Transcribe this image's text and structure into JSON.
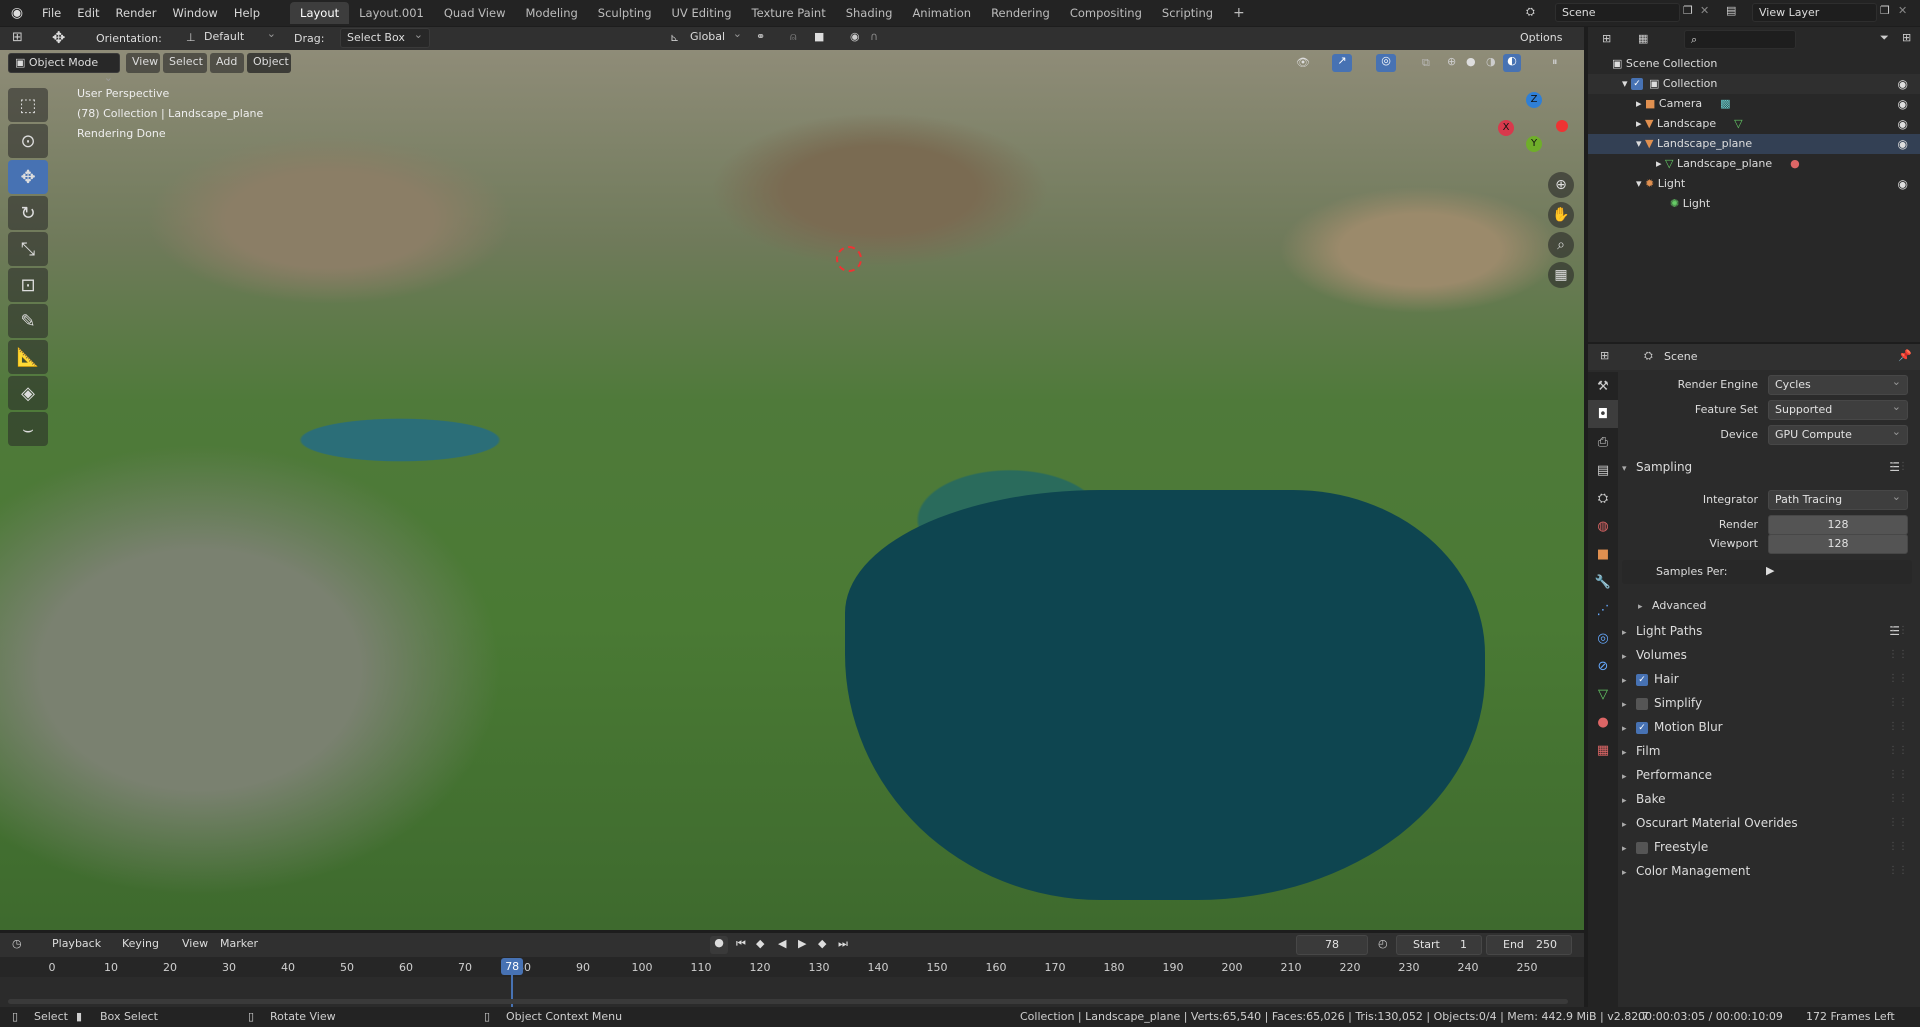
{
  "topbar": {
    "menus": [
      "File",
      "Edit",
      "Render",
      "Window",
      "Help"
    ],
    "workspaces": [
      "Layout",
      "Layout.001",
      "Quad View",
      "Modeling",
      "Sculpting",
      "UV Editing",
      "Texture Paint",
      "Shading",
      "Animation",
      "Rendering",
      "Compositing",
      "Scripting"
    ],
    "add_tab": "+",
    "scene": "Scene",
    "view_layer": "View Layer"
  },
  "view_header": {
    "orientation_label": "Orientation:",
    "orientation_value": "Default",
    "drag_label": "Drag:",
    "drag_value": "Select Box",
    "transform_orientation": "Global",
    "options": "Options",
    "mode": "Object Mode",
    "view": "View",
    "select": "Select",
    "add": "Add",
    "object": "Object"
  },
  "viewport": {
    "perspective": "User Perspective",
    "collection": "(78) Collection | Landscape_plane",
    "status": "Rendering Done",
    "gizmo_axes": {
      "x": "X",
      "y": "Y",
      "z": "Z"
    }
  },
  "outliner": {
    "root": "Scene Collection",
    "items": [
      {
        "label": "Collection",
        "indent": 1
      },
      {
        "label": "Camera",
        "indent": 2
      },
      {
        "label": "Landscape",
        "indent": 2
      },
      {
        "label": "Landscape_plane",
        "indent": 2
      },
      {
        "label": "Landscape_plane",
        "indent": 3
      },
      {
        "label": "Light",
        "indent": 2
      },
      {
        "label": "Light",
        "indent": 3
      }
    ]
  },
  "properties": {
    "context": "Scene",
    "render_engine_label": "Render Engine",
    "render_engine": "Cycles",
    "feature_set_label": "Feature Set",
    "feature_set": "Supported",
    "device_label": "Device",
    "device": "GPU Compute",
    "sampling": "Sampling",
    "integrator_label": "Integrator",
    "integrator": "Path Tracing",
    "render_label": "Render",
    "render_samples": "128",
    "viewport_label": "Viewport",
    "viewport_samples": "128",
    "samples_per": "Samples Per:",
    "advanced": "Advanced",
    "panels": [
      {
        "label": "Light Paths",
        "checkbox": null
      },
      {
        "label": "Volumes",
        "checkbox": null
      },
      {
        "label": "Hair",
        "checkbox": true
      },
      {
        "label": "Simplify",
        "checkbox": false
      },
      {
        "label": "Motion Blur",
        "checkbox": true
      },
      {
        "label": "Film",
        "checkbox": null
      },
      {
        "label": "Performance",
        "checkbox": null
      },
      {
        "label": "Bake",
        "checkbox": null
      },
      {
        "label": "Oscurart Material Overides",
        "checkbox": null
      },
      {
        "label": "Freestyle",
        "checkbox": false
      },
      {
        "label": "Color Management",
        "checkbox": null
      }
    ]
  },
  "timeline": {
    "playback": "Playback",
    "keying": "Keying",
    "view": "View",
    "marker": "Marker",
    "current_frame": "78",
    "start_label": "Start",
    "start": "1",
    "end_label": "End",
    "end": "250",
    "ticks": [
      "0",
      "10",
      "20",
      "30",
      "40",
      "50",
      "60",
      "70",
      "80",
      "90",
      "100",
      "110",
      "120",
      "130",
      "140",
      "150",
      "160",
      "170",
      "180",
      "190",
      "200",
      "210",
      "220",
      "230",
      "240",
      "250"
    ]
  },
  "statusbar": {
    "select": "Select",
    "box_select": "Box Select",
    "rotate_view": "Rotate View",
    "context_menu": "Object Context Menu",
    "stats": "Collection | Landscape_plane | Verts:65,540 | Faces:65,026 | Tris:130,052 | Objects:0/4 | Mem: 442.9 MiB | v2.82.7",
    "time": "00:00:03:05 / 00:00:10:09",
    "frames_left": "172 Frames Left"
  }
}
